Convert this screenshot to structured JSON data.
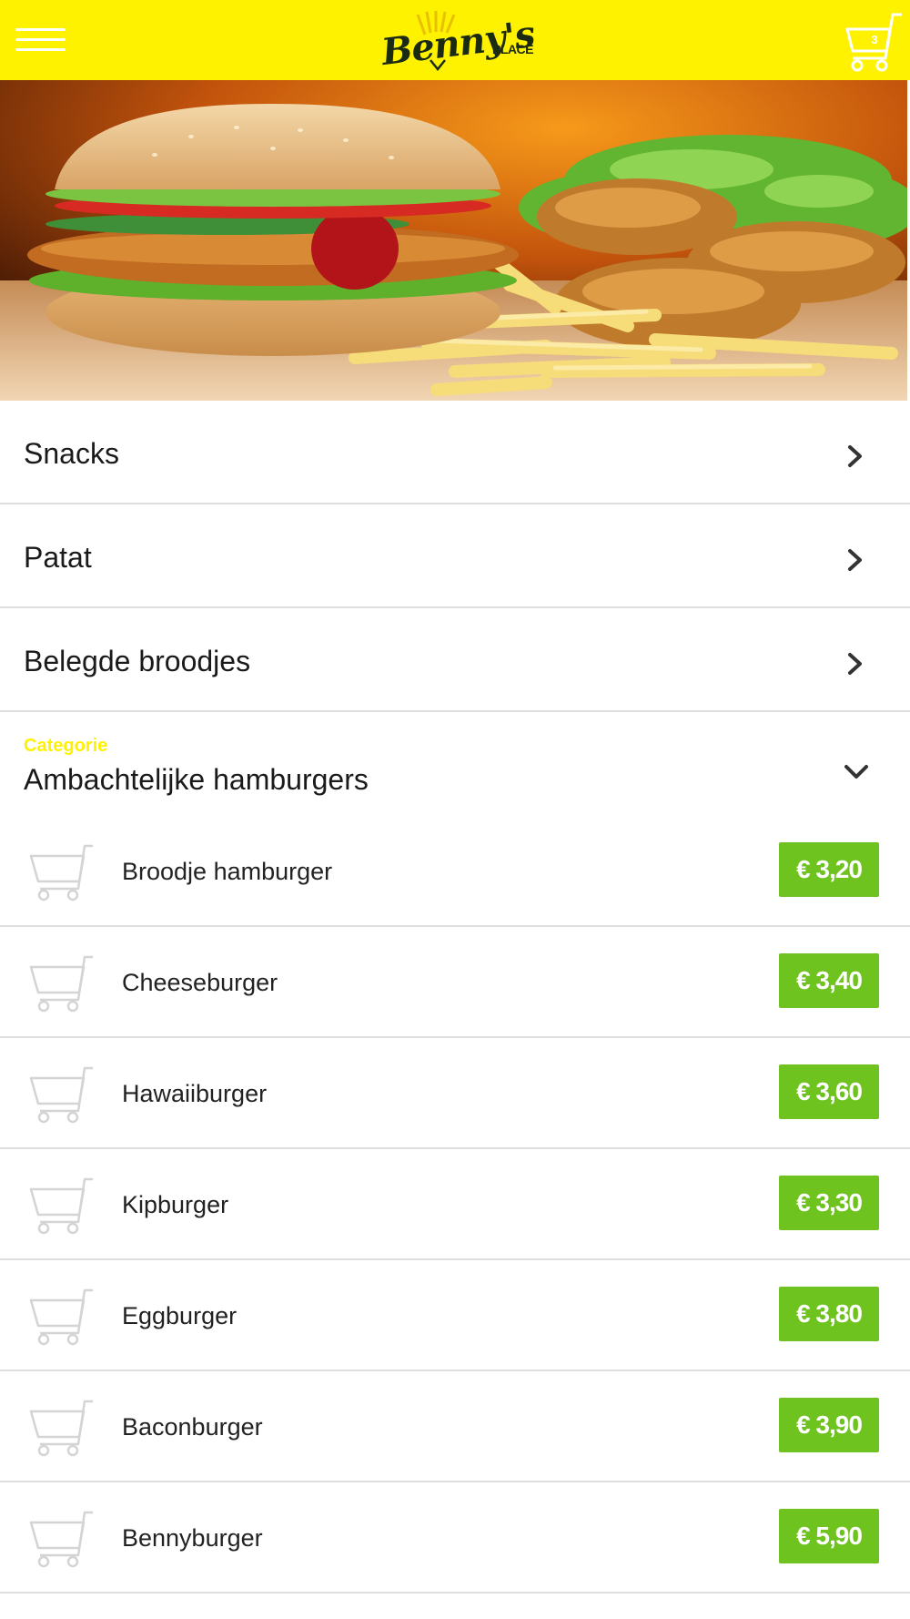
{
  "header": {
    "logo_text": "Benny's",
    "logo_sub": "PLACE",
    "cart_count": "3",
    "bg_color": "#fff200"
  },
  "hero": {
    "icon": "burger-fries-photo"
  },
  "categories": [
    {
      "label": "Snacks"
    },
    {
      "label": "Patat"
    },
    {
      "label": "Belegde broodjes"
    }
  ],
  "open_category": {
    "small_label": "Categorie",
    "title": "Ambachtelijke hamburgers"
  },
  "items": [
    {
      "name": "Broodje hamburger",
      "price": "€ 3,20"
    },
    {
      "name": "Cheeseburger",
      "price": "€ 3,40"
    },
    {
      "name": "Hawaiiburger",
      "price": "€ 3,60"
    },
    {
      "name": "Kipburger",
      "price": "€ 3,30"
    },
    {
      "name": "Eggburger",
      "price": "€ 3,80"
    },
    {
      "name": "Baconburger",
      "price": "€ 3,90"
    },
    {
      "name": "Bennyburger",
      "price": "€ 5,90"
    }
  ],
  "colors": {
    "accent": "#fff200",
    "price_bg": "#6fc31f",
    "divider": "#dedede"
  }
}
